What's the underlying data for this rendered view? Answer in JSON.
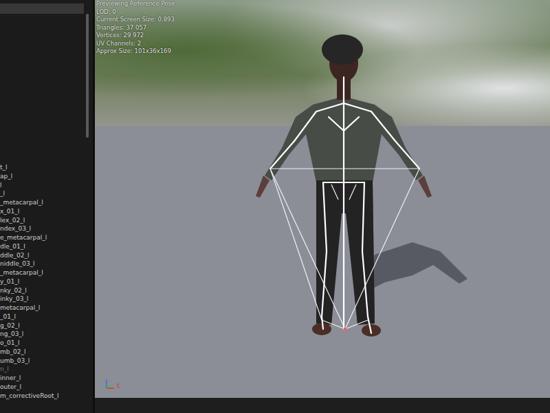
{
  "bone_tree": {
    "rows": [
      {
        "label": "t_l",
        "greyed": false
      },
      {
        "label": "ap_l",
        "greyed": false
      },
      {
        "label": "l",
        "greyed": false
      },
      {
        "label": "_l",
        "greyed": false
      },
      {
        "label": "_metacarpal_l",
        "greyed": false
      },
      {
        "label": "x_01_l",
        "greyed": false
      },
      {
        "label": "lex_02_l",
        "greyed": false
      },
      {
        "label": "ndex_03_l",
        "greyed": false
      },
      {
        "label": "e_metacarpal_l",
        "greyed": false
      },
      {
        "label": "dle_01_l",
        "greyed": false
      },
      {
        "label": "ddle_02_l",
        "greyed": false
      },
      {
        "label": "niddle_03_l",
        "greyed": false
      },
      {
        "label": "_metacarpal_l",
        "greyed": false
      },
      {
        "label": "y_01_l",
        "greyed": false
      },
      {
        "label": "nky_02_l",
        "greyed": false
      },
      {
        "label": "inky_03_l",
        "greyed": false
      },
      {
        "label": "metacarpal_l",
        "greyed": false
      },
      {
        "label": "_01_l",
        "greyed": false
      },
      {
        "label": "g_02_l",
        "greyed": false
      },
      {
        "label": "ng_03_l",
        "greyed": false
      },
      {
        "label": "o_01_l",
        "greyed": false
      },
      {
        "label": "mb_02_l",
        "greyed": false
      },
      {
        "label": "umb_03_l",
        "greyed": false
      },
      {
        "label": "n_l",
        "greyed": true
      },
      {
        "label": "inner_l",
        "greyed": false
      },
      {
        "label": "outer_l",
        "greyed": false
      },
      {
        "label": "m_correctiveRoot_l",
        "greyed": false
      }
    ]
  },
  "viewport": {
    "stats": [
      "Previewing Reference Pose",
      "LOD: 0",
      "Current Screen Size: 0,893",
      "Triangles: 37 057",
      "Vertices: 29 972",
      "UV Channels: 2",
      "Approx Size: 101x36x169"
    ],
    "axis_labels": [
      {
        "label": "X",
        "color": "#d23a3a"
      }
    ]
  }
}
